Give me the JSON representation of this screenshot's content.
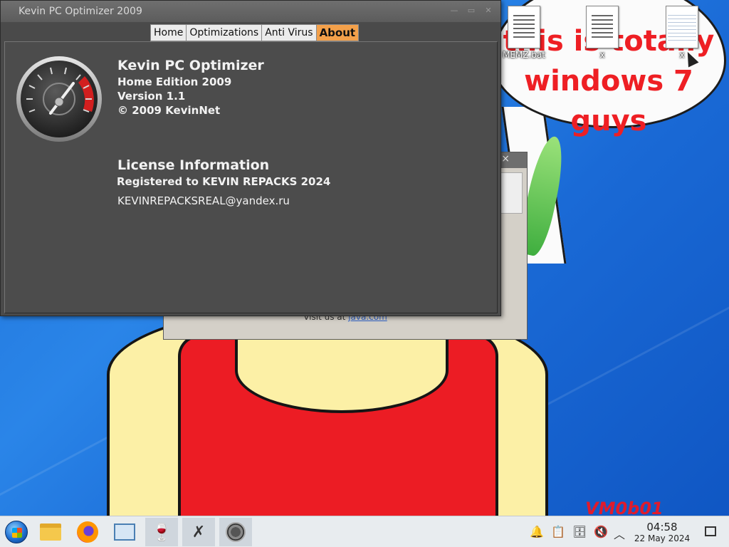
{
  "desktop": {
    "wallpaper_text": "this is totally\nwindows 7 guys",
    "watermark": "VM0b01",
    "icons": [
      {
        "label": "MEMZ.bat",
        "icon": "batch-file-icon"
      },
      {
        "label": "x",
        "icon": "text-file-icon"
      },
      {
        "label": "x",
        "icon": "blank-file-icon"
      }
    ]
  },
  "background_window": {
    "visit_prefix": "Visit us at ",
    "visit_link": "java.com",
    "close_glyph": "×"
  },
  "main_window": {
    "title": "Kevin PC Optimizer 2009",
    "buttons": {
      "minimize": "—",
      "maximize": "▭",
      "close": "✕"
    },
    "tabs": [
      {
        "label": "Home",
        "active": false
      },
      {
        "label": "Optimizations",
        "active": false
      },
      {
        "label": "Anti Virus",
        "active": false
      },
      {
        "label": "About",
        "active": true
      }
    ],
    "about": {
      "product": "Kevin PC Optimizer",
      "edition": "Home Edition 2009",
      "version": "Version 1.1",
      "copyright": "© 2009 KevinNet",
      "license_heading": "License Information",
      "registered_to": "Registered to KEVIN REPACKS 2024",
      "email": "KEVINREPACKSREAL@yandex.ru"
    },
    "logo_icon": "speedometer-gauge-icon"
  },
  "taskbar": {
    "items": [
      {
        "name": "start-button",
        "icon": "windows-orb-icon"
      },
      {
        "name": "file-manager",
        "icon": "folder-icon"
      },
      {
        "name": "firefox",
        "icon": "firefox-icon"
      },
      {
        "name": "system-monitor",
        "icon": "monitor-icon"
      },
      {
        "name": "wine",
        "icon": "wine-glass-icon"
      },
      {
        "name": "xkill",
        "icon": "x-icon"
      },
      {
        "name": "kevin-optimizer",
        "icon": "gauge-icon"
      }
    ],
    "tray": {
      "notifications": "🔔",
      "clipboard": "📋",
      "storage": "🗄",
      "volume": "🔇",
      "expand": "︿"
    },
    "clock": {
      "time": "04:58",
      "date": "22 May 2024"
    }
  }
}
